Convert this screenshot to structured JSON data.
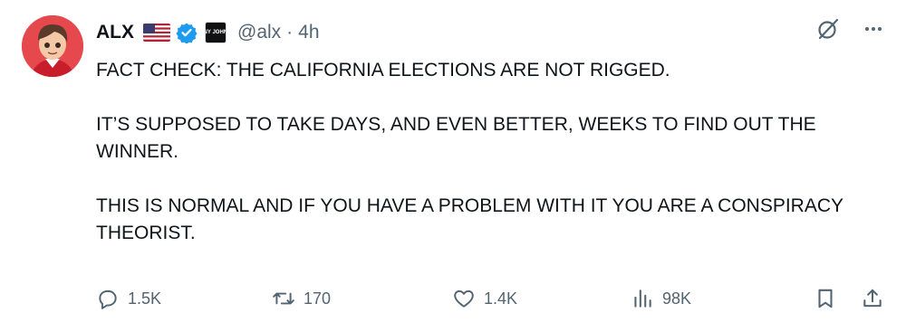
{
  "author": {
    "name": "ALX",
    "handle": "@alx",
    "separator": "·",
    "time": "4h",
    "affiliation_badge_text": "BENNY JOHNSON"
  },
  "icons": {
    "flag": "us-flag-icon",
    "verified": "verified-badge-icon",
    "grok": "grok-icon",
    "more": "more-icon",
    "reply": "reply-icon",
    "retweet": "retweet-icon",
    "like": "like-icon",
    "views": "views-icon",
    "bookmark": "bookmark-icon",
    "share": "share-icon"
  },
  "colors": {
    "verified": "#1d9bf0",
    "text": "#0f1419",
    "secondary": "#536471"
  },
  "body": {
    "paragraph_1": "FACT CHECK: THE CALIFORNIA ELECTIONS ARE NOT RIGGED.",
    "paragraph_2": "IT’S SUPPOSED TO TAKE DAYS, AND EVEN BETTER, WEEKS TO FIND OUT THE WINNER.",
    "paragraph_3": "THIS IS NORMAL AND IF YOU HAVE A PROBLEM WITH IT YOU ARE A CONSPIRACY THEORIST."
  },
  "actions": {
    "replies": "1.5K",
    "retweets": "170",
    "likes": "1.4K",
    "views": "98K"
  }
}
